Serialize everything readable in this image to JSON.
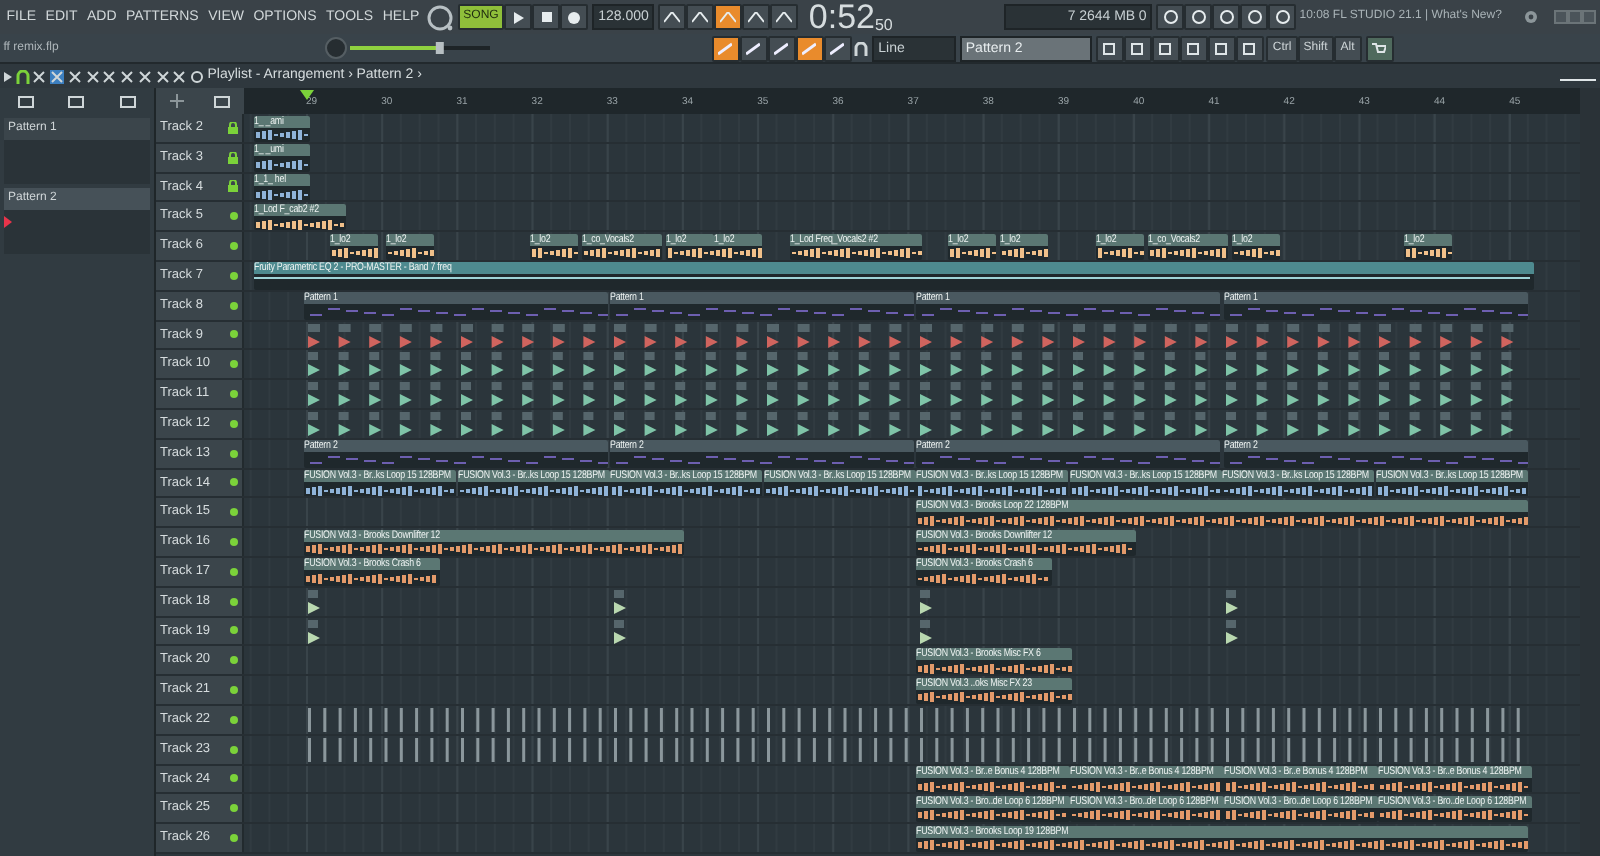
{
  "menu": [
    "FILE",
    "EDIT",
    "ADD",
    "PATTERNS",
    "VIEW",
    "OPTIONS",
    "TOOLS",
    "HELP"
  ],
  "transport": {
    "mode": "SONG",
    "song_selected": true,
    "tempo": "128.000",
    "time": "0:52",
    "time_centis": "50"
  },
  "performance": {
    "cpu": "7",
    "memory": "2644 MB",
    "polyphony": "0"
  },
  "hint_bar": "10:08 FL STUDIO 21.1 | What's New?",
  "file_name": "ff remix.flp",
  "snap": "Line",
  "pattern": "Pattern 2",
  "modifiers": [
    "Ctrl",
    "Shift",
    "Alt"
  ],
  "master_volume": {
    "level": 0.65
  },
  "playlist": {
    "title": "Playlist - Arrangement ›",
    "breadcrumb": "Pattern 2 ›"
  },
  "ruler": [
    "29",
    "30",
    "31",
    "32",
    "33",
    "34",
    "35",
    "36",
    "37",
    "38",
    "39",
    "40",
    "41",
    "42",
    "43",
    "44",
    "45"
  ],
  "patterns": [
    {
      "label": "Pattern 1",
      "selected": false
    },
    {
      "label": "Pattern 2",
      "selected": true
    }
  ],
  "tracks": [
    {
      "name": "Track 2",
      "locked": true,
      "kind": "clips",
      "clips": [
        {
          "kind": "audio",
          "label": "1_ _ami"
        }
      ]
    },
    {
      "name": "Track 3",
      "locked": true,
      "kind": "clips",
      "clips": [
        {
          "kind": "audio",
          "label": "1_ _umi"
        }
      ]
    },
    {
      "name": "Track 4",
      "locked": true,
      "kind": "clips",
      "clips": [
        {
          "kind": "audio",
          "label": "1_1_ hel"
        }
      ]
    },
    {
      "name": "Track 5",
      "locked": false,
      "kind": "clips",
      "clips": [
        {
          "kind": "audio",
          "label": "1_Lod F_cab2 #2"
        }
      ]
    },
    {
      "name": "Track 6",
      "locked": false,
      "kind": "clips",
      "clips": [
        {
          "kind": "audio",
          "label": "1_lo2"
        },
        {
          "kind": "audio",
          "label": "1_lo2"
        },
        {
          "kind": "audio",
          "label": "1_lo2"
        },
        {
          "kind": "audio",
          "label": "1_co_Vocals2"
        },
        {
          "kind": "audio",
          "label": "1_lo2"
        },
        {
          "kind": "audio",
          "label": "1_lo2"
        },
        {
          "kind": "audio",
          "label": "1_Lod Freq_Vocals2 #2"
        },
        {
          "kind": "audio",
          "label": "1_lo2"
        },
        {
          "kind": "audio",
          "label": "1_lo2"
        },
        {
          "kind": "audio",
          "label": "1_lo2"
        },
        {
          "kind": "audio",
          "label": "1_co_Vocals2"
        },
        {
          "kind": "audio",
          "label": "1_lo2"
        },
        {
          "kind": "audio",
          "label": "1_lo2"
        }
      ]
    },
    {
      "name": "Track 7",
      "locked": false,
      "kind": "clips",
      "clips": [
        {
          "kind": "automation",
          "label": "Fruity Parametric EQ 2 - PRO-MASTER - Band 7 freq"
        }
      ]
    },
    {
      "name": "Track 8",
      "locked": false,
      "kind": "clips",
      "clips": [
        {
          "kind": "pattern",
          "label": "Pattern 1"
        },
        {
          "kind": "pattern",
          "label": "Pattern 1"
        },
        {
          "kind": "pattern",
          "label": "Pattern 1"
        },
        {
          "kind": "pattern",
          "label": "Pattern 1"
        }
      ]
    },
    {
      "name": "Track 9",
      "locked": false,
      "kind": "hits"
    },
    {
      "name": "Track 10",
      "locked": false,
      "kind": "hits"
    },
    {
      "name": "Track 11",
      "locked": false,
      "kind": "hits"
    },
    {
      "name": "Track 12",
      "locked": false,
      "kind": "hits"
    },
    {
      "name": "Track 13",
      "locked": false,
      "kind": "clips",
      "clips": [
        {
          "kind": "pattern",
          "label": "Pattern 2"
        },
        {
          "kind": "pattern",
          "label": "Pattern 2"
        },
        {
          "kind": "pattern",
          "label": "Pattern 2"
        },
        {
          "kind": "pattern",
          "label": "Pattern 2"
        }
      ]
    },
    {
      "name": "Track 14",
      "locked": false,
      "kind": "clips",
      "clips": [
        {
          "kind": "audio",
          "label": "FUSION Vol.3 - Br..ks Loop 15 128BPM"
        },
        {
          "kind": "audio",
          "label": "FUSION Vol.3 - Br..ks Loop 15 128BPM"
        },
        {
          "kind": "audio",
          "label": "FUSION Vol.3 - Br..ks Loop 15 128BPM"
        },
        {
          "kind": "audio",
          "label": "FUSION Vol.3 - Br..ks Loop 15 128BPM"
        },
        {
          "kind": "audio",
          "label": "FUSION Vol.3 - Br..ks Loop 15 128BPM"
        },
        {
          "kind": "audio",
          "label": "FUSION Vol.3 - Br..ks Loop 15 128BPM"
        },
        {
          "kind": "audio",
          "label": "FUSION Vol.3 - Br..ks Loop 15 128BPM"
        },
        {
          "kind": "audio",
          "label": "FUSION Vol.3 - Br..ks Loop 15 128BPM"
        }
      ]
    },
    {
      "name": "Track 15",
      "locked": false,
      "kind": "clips",
      "clips": [
        {
          "kind": "audio",
          "label": "FUSION Vol.3 - Brooks Loop 22 128BPM"
        }
      ]
    },
    {
      "name": "Track 16",
      "locked": false,
      "kind": "clips",
      "clips": [
        {
          "kind": "audio",
          "label": "FUSION Vol.3 - Brooks Downlifter 12"
        },
        {
          "kind": "audio",
          "label": "FUSION Vol.3 - Brooks Downlifter 12"
        }
      ]
    },
    {
      "name": "Track 17",
      "locked": false,
      "kind": "clips",
      "clips": [
        {
          "kind": "audio",
          "label": "FUSION Vol.3 - Brooks Crash 6"
        },
        {
          "kind": "audio",
          "label": "FUSION Vol.3 - Brooks Crash 6"
        }
      ]
    },
    {
      "name": "Track 18",
      "locked": false,
      "kind": "hits"
    },
    {
      "name": "Track 19",
      "locked": false,
      "kind": "hits"
    },
    {
      "name": "Track 20",
      "locked": false,
      "kind": "clips",
      "clips": [
        {
          "kind": "audio",
          "label": "FUSION Vol.3 - Brooks Misc FX 6"
        }
      ]
    },
    {
      "name": "Track 21",
      "locked": false,
      "kind": "clips",
      "clips": [
        {
          "kind": "audio",
          "label": "FUSION Vol.3 ..oks Misc FX 23"
        }
      ]
    },
    {
      "name": "Track 22",
      "locked": false,
      "kind": "ticks"
    },
    {
      "name": "Track 23",
      "locked": false,
      "kind": "ticks"
    },
    {
      "name": "Track 24",
      "locked": false,
      "kind": "clips",
      "clips": [
        {
          "kind": "audio",
          "label": "FUSION Vol.3 - Br..e Bonus 4 128BPM"
        },
        {
          "kind": "audio",
          "label": "FUSION Vol.3 - Br..e Bonus 4 128BPM"
        },
        {
          "kind": "audio",
          "label": "FUSION Vol.3 - Br..e Bonus 4 128BPM"
        },
        {
          "kind": "audio",
          "label": "FUSION Vol.3 - Br..e Bonus 4 128BPM"
        }
      ]
    },
    {
      "name": "Track 25",
      "locked": false,
      "kind": "clips",
      "clips": [
        {
          "kind": "audio",
          "label": "FUSION Vol.3 - Bro..de Loop 6 128BPM"
        },
        {
          "kind": "audio",
          "label": "FUSION Vol.3 - Bro..de Loop 6 128BPM"
        },
        {
          "kind": "audio",
          "label": "FUSION Vol.3 - Bro..de Loop 6 128BPM"
        },
        {
          "kind": "audio",
          "label": "FUSION Vol.3 - Bro..de Loop 6 128BPM"
        }
      ]
    },
    {
      "name": "Track 26",
      "locked": false,
      "kind": "clips",
      "clips": [
        {
          "kind": "audio",
          "label": "FUSION Vol.3 - Brooks Loop 19 128BPM"
        }
      ]
    }
  ]
}
